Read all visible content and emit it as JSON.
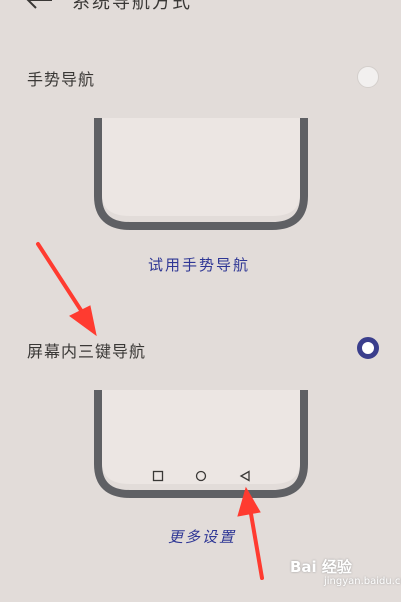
{
  "header": {
    "title": "系统导航方式",
    "back_icon": "back-arrow-icon"
  },
  "options": [
    {
      "label": "手势导航",
      "selected": false,
      "link": "试用手势导航"
    },
    {
      "label": "屏幕内三键导航",
      "selected": true,
      "link": "更多设置"
    }
  ],
  "nav_keys": [
    "recent-apps-icon",
    "home-icon",
    "back-triangle-icon"
  ],
  "colors": {
    "background": "#e2dcd9",
    "accent": "#3a3e8c",
    "link": "#2f3795",
    "phone_frame": "#5f6064",
    "annotation": "#ff3b30"
  },
  "watermark": {
    "text": "Bai 经验",
    "url": "jingyan.baidu.com"
  }
}
